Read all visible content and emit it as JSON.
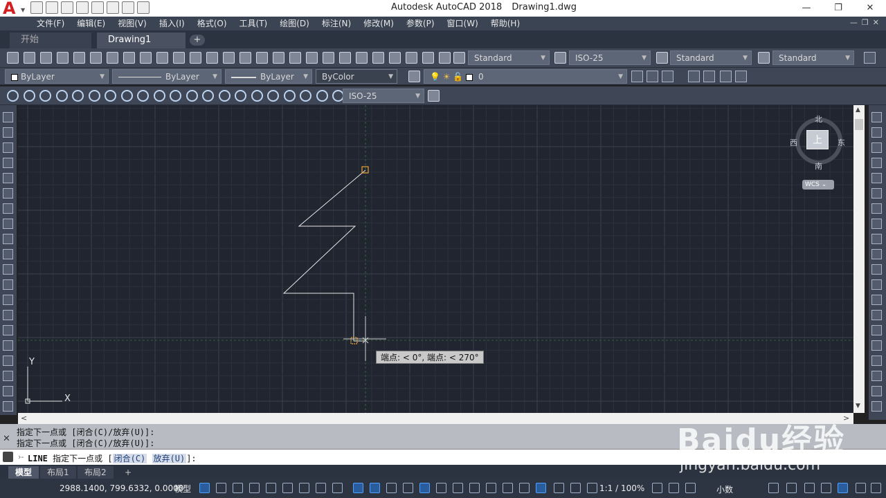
{
  "title": {
    "app": "Autodesk AutoCAD 2018",
    "file": "Drawing1.dwg"
  },
  "menu": [
    "文件(F)",
    "编辑(E)",
    "视图(V)",
    "插入(I)",
    "格式(O)",
    "工具(T)",
    "绘图(D)",
    "标注(N)",
    "修改(M)",
    "参数(P)",
    "窗口(W)",
    "帮助(H)"
  ],
  "tabs": {
    "start": "开始",
    "drawing": "Drawing1",
    "add": "+"
  },
  "styles": {
    "text_style": "Standard",
    "dim_style": "ISO-25",
    "table_style": "Standard",
    "multileader_style": "Standard"
  },
  "properties": {
    "color": "ByLayer",
    "linetype": "ByLayer",
    "lineweight": "ByLayer",
    "plotstyle": "ByColor",
    "layer": "0"
  },
  "dim_toolbar": {
    "dim_style": "ISO-25"
  },
  "viewcube": {
    "north": "北",
    "south": "南",
    "east": "东",
    "west": "西",
    "top": "上",
    "wcs": "WCS"
  },
  "canvas": {
    "tooltip": "端点: < 0°, 端点: < 270°",
    "ucs_x": "X",
    "ucs_y": "Y"
  },
  "command": {
    "history_1": "指定下一点或 [闭合(C)/放弃(U)]:",
    "history_2": "指定下一点或 [闭合(C)/放弃(U)]:",
    "cmd_name": "LINE",
    "prompt": "指定下一点或 [",
    "option_close": "闭合(C)",
    "option_undo": "放弃(U)",
    "prompt_end": "]:"
  },
  "layout_tabs": [
    "模型",
    "布局1",
    "布局2"
  ],
  "status": {
    "coords": "2988.1400, 799.6332, 0.0000",
    "model": "模型",
    "scale": "1:1 / 100%",
    "units": "小数"
  },
  "watermark": {
    "brand": "Baidu经验",
    "url": "jingyan.baidu.com"
  }
}
